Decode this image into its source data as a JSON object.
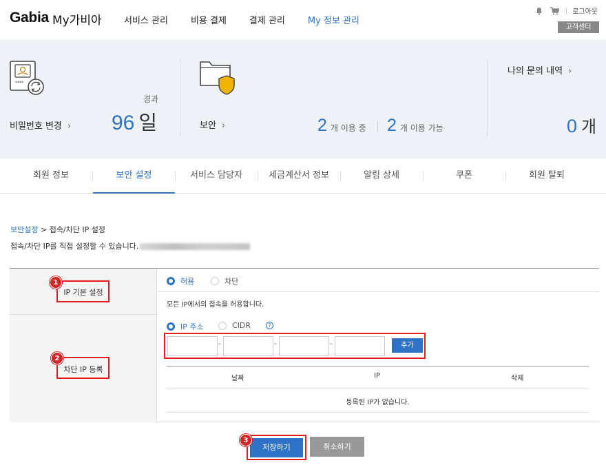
{
  "header": {
    "logo": "Gabia",
    "logo_sub": "My가비아",
    "nav": [
      "서비스 관리",
      "비용 결제",
      "결제 관리",
      "My 정보 관리"
    ],
    "logout": "로그아웃",
    "customer_center": "고객센터"
  },
  "summary": {
    "password": {
      "label": "비밀번호 변경",
      "elapsed_label": "경과",
      "days": "96",
      "unit": "일"
    },
    "security": {
      "label": "보안",
      "in_use_num": "2",
      "in_use_text": "개 이용 중",
      "available_num": "2",
      "available_text": "개 이용 가능"
    },
    "inquiry": {
      "label": "나의 문의 내역",
      "count": "0",
      "unit": "개"
    }
  },
  "tabs": [
    "회원 정보",
    "보안 설정",
    "서비스 담당자",
    "세금계산서 정보",
    "알림 상세",
    "쿠폰",
    "회원 탈퇴"
  ],
  "breadcrumb": {
    "link": "보안설정",
    "current": " > 접속/차단 IP 설정"
  },
  "description": "접속/차단 IP를 직접 설정할 수 있습니다.",
  "basic": {
    "label": "IP 기본 설정",
    "allow": "허용",
    "block": "차단",
    "info": "모든 IP에서의 접속을 허용합니다."
  },
  "block_ip": {
    "label": "차단 IP 등록",
    "ip_option": "IP 주소",
    "cidr_option": "CIDR",
    "help": "?",
    "dash": "-",
    "add": "추가",
    "col_date": "날짜",
    "col_ip": "IP",
    "col_delete": "삭제",
    "empty": "등록된 IP가 없습니다."
  },
  "badges": [
    "1",
    "2",
    "3"
  ],
  "buttons": {
    "save": "저장하기",
    "cancel": "취소하기"
  },
  "colors": {
    "accent": "#2f73c6",
    "highlight": "#e02020"
  }
}
